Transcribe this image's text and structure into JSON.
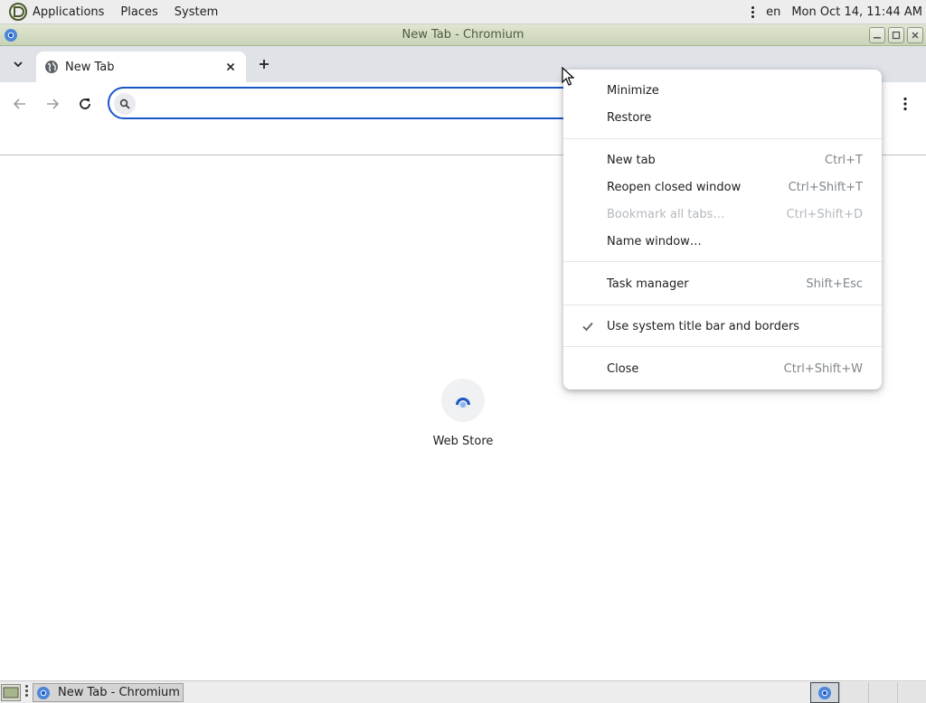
{
  "top_panel": {
    "menus": [
      "Applications",
      "Places",
      "System"
    ],
    "language": "en",
    "clock": "Mon Oct 14, 11:44 AM"
  },
  "window": {
    "title": "New Tab - Chromium"
  },
  "tabs": [
    {
      "title": "New Tab"
    }
  ],
  "omnibox": {
    "value": "",
    "placeholder": ""
  },
  "new_tab_page": {
    "shortcuts": [
      {
        "label": "Web Store"
      }
    ]
  },
  "context_menu": {
    "items": [
      {
        "label": "Minimize",
        "shortcut": ""
      },
      {
        "label": "Restore",
        "shortcut": ""
      },
      {
        "label": "New tab",
        "shortcut": "Ctrl+T"
      },
      {
        "label": "Reopen closed window",
        "shortcut": "Ctrl+Shift+T"
      },
      {
        "label": "Bookmark all tabs…",
        "shortcut": "Ctrl+Shift+D",
        "disabled": true
      },
      {
        "label": "Name window…",
        "shortcut": ""
      },
      {
        "label": "Task manager",
        "shortcut": "Shift+Esc"
      },
      {
        "label": "Use system title bar and borders",
        "shortcut": "",
        "checked": true
      },
      {
        "label": "Close",
        "shortcut": "Ctrl+Shift+W"
      }
    ]
  },
  "taskbar": {
    "tasks": [
      {
        "label": "New Tab - Chromium"
      }
    ]
  },
  "colors": {
    "accent": "#1a57c6",
    "titlebar": "#c9d3b6",
    "tabstrip": "#dfe3e8"
  }
}
